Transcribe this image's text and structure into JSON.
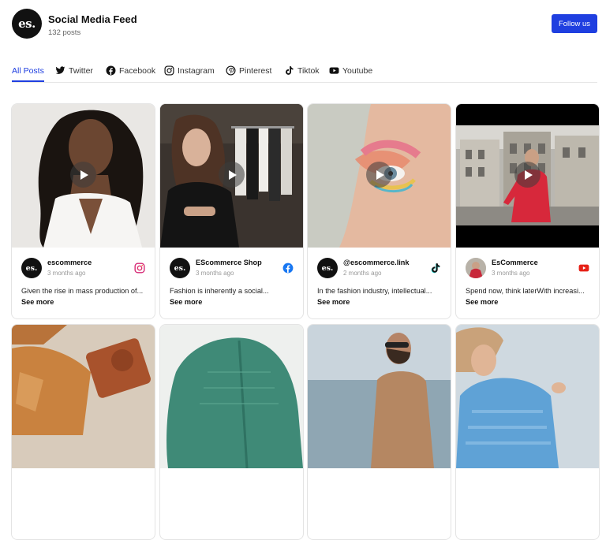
{
  "feed": {
    "logo_text": "es.",
    "title": "Social Media Feed",
    "count": "132 posts",
    "follow_label": "Follow us"
  },
  "tabs": [
    {
      "label": "All Posts",
      "icon": "none",
      "active": true
    },
    {
      "label": "Twitter",
      "icon": "twitter-icon"
    },
    {
      "label": "Facebook",
      "icon": "facebook-icon"
    },
    {
      "label": "Instagram",
      "icon": "instagram-icon"
    },
    {
      "label": "Pinterest",
      "icon": "pinterest-icon"
    },
    {
      "label": "Tiktok",
      "icon": "tiktok-icon"
    },
    {
      "label": "Youtube",
      "icon": "youtube-icon"
    }
  ],
  "posts": [
    {
      "author": "escommerce",
      "time": "3 months ago",
      "caption": "Given the rise in mass production of...",
      "see_more": "See more",
      "source": "instagram-icon",
      "avatar": "es."
    },
    {
      "author": "EScommerce Shop",
      "time": "3 months ago",
      "caption": "Fashion is inherently a social...",
      "see_more": "See more",
      "source": "facebook-icon",
      "avatar": "es."
    },
    {
      "author": "@escommerce.link",
      "time": "2 months ago",
      "caption": "In the fashion industry, intellectual...",
      "see_more": "See more",
      "source": "tiktok-icon",
      "avatar": "es."
    },
    {
      "author": "EsCommerce",
      "time": "3 months ago",
      "caption": "Spend now, think laterWith increasi...",
      "see_more": "See more",
      "source": "youtube-icon",
      "avatar": ""
    }
  ],
  "colors": {
    "accent": "#1f3fe0",
    "instagram": "#d62976",
    "facebook": "#1877f2",
    "youtube": "#e62117"
  }
}
